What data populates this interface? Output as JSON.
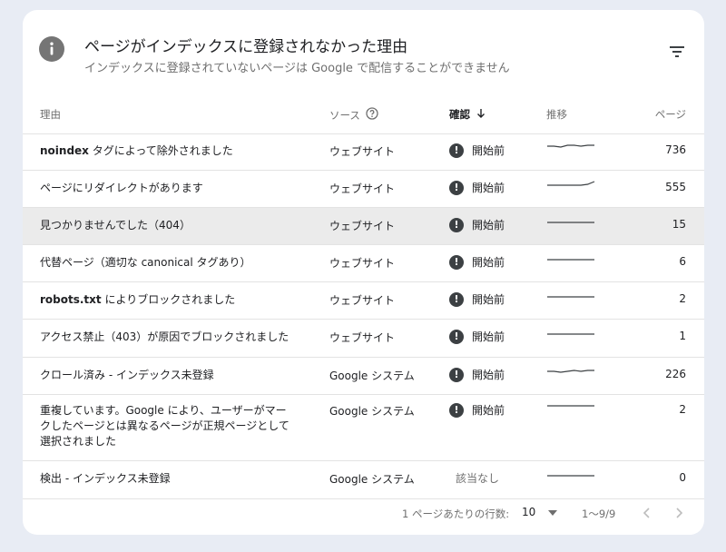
{
  "header": {
    "title": "ページがインデックスに登録されなかった理由",
    "subtitle": "インデックスに登録されていないページは Google で配信することができません"
  },
  "columns": {
    "reason": "理由",
    "source": "ソース",
    "verify": "確認",
    "trend": "推移",
    "pages": "ページ"
  },
  "rows": [
    {
      "reason_bold": "noindex",
      "reason": " タグによって除外されました",
      "source": "ウェブサイト",
      "status": "開始前",
      "pages": "736",
      "trend": [
        8,
        8,
        9,
        7,
        7,
        8,
        7,
        7
      ]
    },
    {
      "reason_bold": "",
      "reason": "ページにリダイレクトがあります",
      "source": "ウェブサイト",
      "status": "開始前",
      "pages": "555",
      "trend": [
        10,
        10,
        10,
        10,
        10,
        10,
        9,
        6
      ]
    },
    {
      "reason_bold": "",
      "reason": "見つかりませんでした（404）",
      "source": "ウェブサイト",
      "status": "開始前",
      "pages": "15",
      "trend": [
        10,
        10,
        10,
        10,
        10,
        10,
        10,
        10
      ]
    },
    {
      "reason_bold": "",
      "reason": "代替ページ（適切な canonical タグあり）",
      "source": "ウェブサイト",
      "status": "開始前",
      "pages": "6",
      "trend": [
        10,
        10,
        10,
        10,
        10,
        10,
        10,
        10
      ]
    },
    {
      "reason_bold": "robots.txt",
      "reason": " によりブロックされました",
      "source": "ウェブサイト",
      "status": "開始前",
      "pages": "2",
      "trend": [
        10,
        10,
        10,
        10,
        10,
        10,
        10,
        10
      ]
    },
    {
      "reason_bold": "",
      "reason": "アクセス禁止（403）が原因でブロックされました",
      "source": "ウェブサイト",
      "status": "開始前",
      "pages": "1",
      "trend": [
        10,
        10,
        10,
        10,
        10,
        10,
        10,
        10
      ]
    },
    {
      "reason_bold": "",
      "reason": "クロール済み - インデックス未登録",
      "source": "Google システム",
      "status": "開始前",
      "pages": "226",
      "trend": [
        9,
        9,
        10,
        9,
        8,
        9,
        8,
        8
      ]
    },
    {
      "reason_bold": "",
      "reason": "重複しています。Google により、ユーザーがマークしたページとは異なるページが正規ページとして選択されました",
      "source": "Google システム",
      "status": "開始前",
      "pages": "2",
      "trend": [
        10,
        10,
        10,
        10,
        10,
        10,
        10,
        10
      ]
    },
    {
      "reason_bold": "",
      "reason": "検出 - インデックス未登録",
      "source": "Google システム",
      "status": "該当なし",
      "pages": "0",
      "trend": [
        10,
        10,
        10,
        10,
        10,
        10,
        10,
        10
      ]
    }
  ],
  "footer": {
    "rows_per_page_label": "1 ページあたりの行数:",
    "rows_per_page_value": "10",
    "range": "1〜9/9"
  },
  "colors": {
    "card": "#ffffff",
    "background": "#e8ecf4",
    "highlight_row": "#ebebeb",
    "status_icon": "#3c4043",
    "info_icon": "#757575"
  }
}
